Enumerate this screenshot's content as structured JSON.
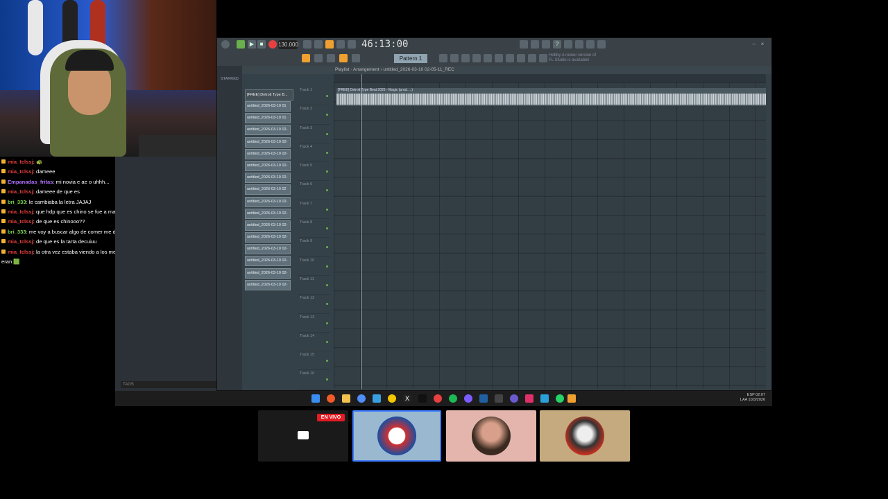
{
  "chat": {
    "messages": [
      {
        "user": "mia_tclssj",
        "sep": ":",
        "text": "🐢",
        "color": "#e84040"
      },
      {
        "user": "mia_tclssj",
        "sep": ":",
        "text": "dameee",
        "color": "#e84040"
      },
      {
        "user": "Empanadas_fritas",
        "sep": ":",
        "text": "mi novia e ae o uhhh...",
        "color": "#b070ff"
      },
      {
        "user": "mia_tclssj",
        "sep": ":",
        "text": "dameee de que es",
        "color": "#e84040"
      },
      {
        "user": "bri_333",
        "sep": ":",
        "text": "le cambiaba la letra JAJAJ",
        "color": "#7ed957"
      },
      {
        "user": "mia_tclssj",
        "sep": ":",
        "text": "que hdp que es chino se fue a mat*r de risa seguro",
        "color": "#e84040"
      },
      {
        "user": "mia_tclssj",
        "sep": ":",
        "text": "de que es chinooo??",
        "color": "#e84040"
      },
      {
        "user": "bri_333",
        "sep": ":",
        "text": "me voy a buscar algo de comer me dio hambre el chino..",
        "color": "#7ed957"
      },
      {
        "user": "mia_tclssj",
        "sep": ":",
        "text": "de que es la tarta decuiuu",
        "color": "#e84040"
      },
      {
        "user": "mia_tclssj",
        "sep": ":",
        "text": "la otra vez estaba viendo a los mernosketti y mi mamá me preguntó si",
        "color": "#e84040"
      },
      {
        "user": "",
        "sep": "",
        "text": "eran 🟩",
        "color": "#ffffff"
      }
    ]
  },
  "fl": {
    "tempo": "130.000",
    "time": "46:13:00",
    "pattern": "Pattern 1",
    "notice_line1": "Hobby  A newer version of",
    "notice_line2": "FL Studio is available!",
    "sidebar_label": "STARRED",
    "playlist_title": "Playlist · Arrangement › untitled_2026-03-10 02-05-11_REC",
    "pattern_header": "[FREE] Detroit Type B...",
    "patterns": [
      "untitled_2026-03-10 01",
      "untitled_2026-03-10 01",
      "untitled_2026-03-10 02-",
      "untitled_2026-03-10 02-",
      "untitled_2026-03-10 02-",
      "untitled_2026-03-10 02-",
      "untitled_2026-03-10 02-",
      "untitled_2026-03-10 02",
      "untitled_2026-03-10 02-",
      "untitled_2026-03-10 02-",
      "untitled_2026-03-10 02-",
      "untitled_2026-03-10 02-",
      "untitled_2026-03-10 02-",
      "untitled_2026-03-10 02-",
      "untitled_2026-03-10 02-",
      "untitled_2026-03-10 02-"
    ],
    "tracks": [
      "Track 1",
      "Track 2",
      "Track 3",
      "Track 4",
      "Track 5",
      "Track 6",
      "Track 7",
      "Track 8",
      "Track 9",
      "Track 10",
      "Track 11",
      "Track 12",
      "Track 13",
      "Track 14",
      "Track 15",
      "Track 16"
    ],
    "audio_clip_label": "[FREE] Detroit Type Beat 2026 - Magic (prod. ...)",
    "tags_label": "TAGS"
  },
  "taskbar": {
    "lang": "ESP",
    "region": "LAA",
    "clock": "02:07",
    "date": "10/3/2026"
  },
  "stream": {
    "live_label": "EN VIVO"
  }
}
